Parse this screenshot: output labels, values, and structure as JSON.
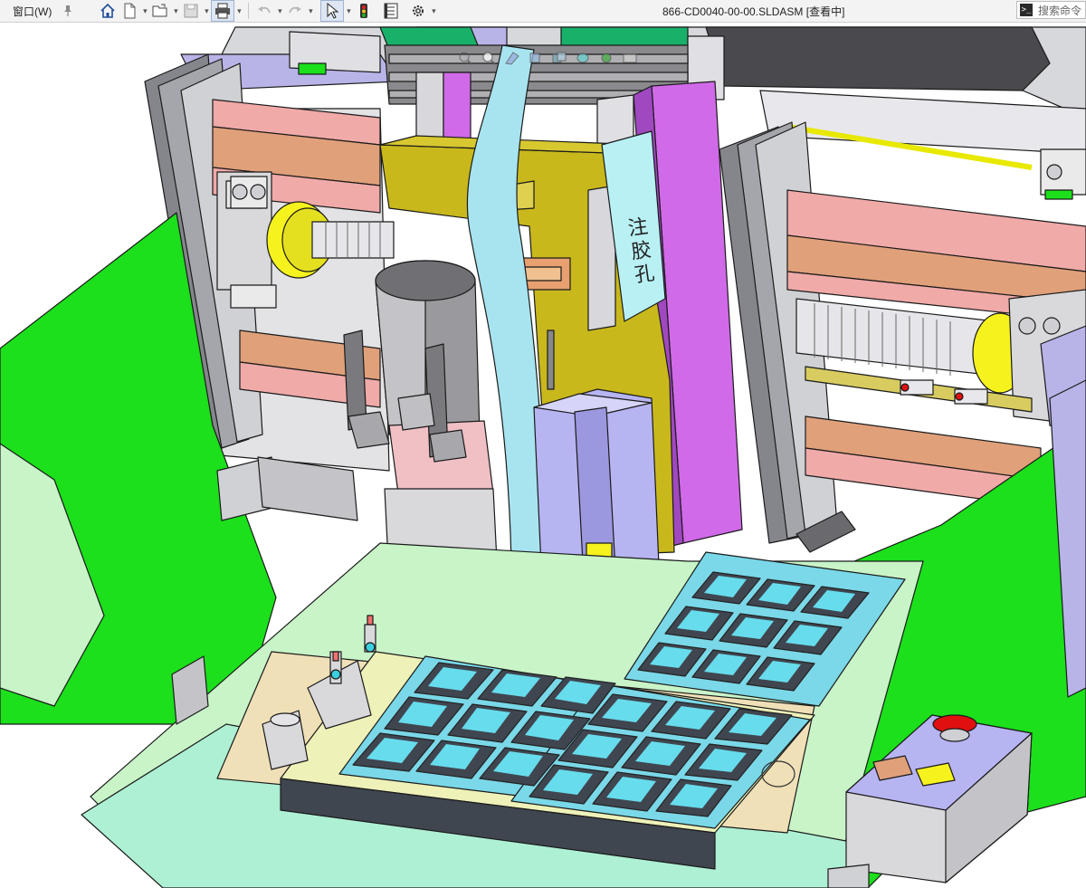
{
  "toolbar": {
    "window_menu_label": "窗口(W)",
    "icons": [
      "pin-icon",
      "home-icon",
      "new-document-icon",
      "open-folder-icon",
      "save-icon",
      "print-icon",
      "undo-icon",
      "redo-icon",
      "select-arrow-icon",
      "traffic-light-icon",
      "file-properties-icon",
      "gear-icon"
    ]
  },
  "window": {
    "title": "866-CD0040-00-00.SLDASM [查看中]"
  },
  "search": {
    "placeholder": "搜索命令"
  },
  "model": {
    "nozzle_label_text": "注胶孔",
    "colors": {
      "frame_green": "#1be01b",
      "tray_base": "#eef1b8",
      "tray_tile_border": "#7ad8e8",
      "tile_dark": "#3f4650",
      "tile_cyan": "#67dcec",
      "rail_pink": "#f0aaa8",
      "rail_orange": "#e0a07a",
      "plate_olive": "#c9b81c",
      "motor_yellow": "#f6f21e",
      "hose_lightblue": "#a8e4f0",
      "head_lavender": "#b7b4f2",
      "brush_red": "#ff1010",
      "panel_magenta": "#d06ae8",
      "plate_lightgreen": "#c8f4c8"
    }
  }
}
